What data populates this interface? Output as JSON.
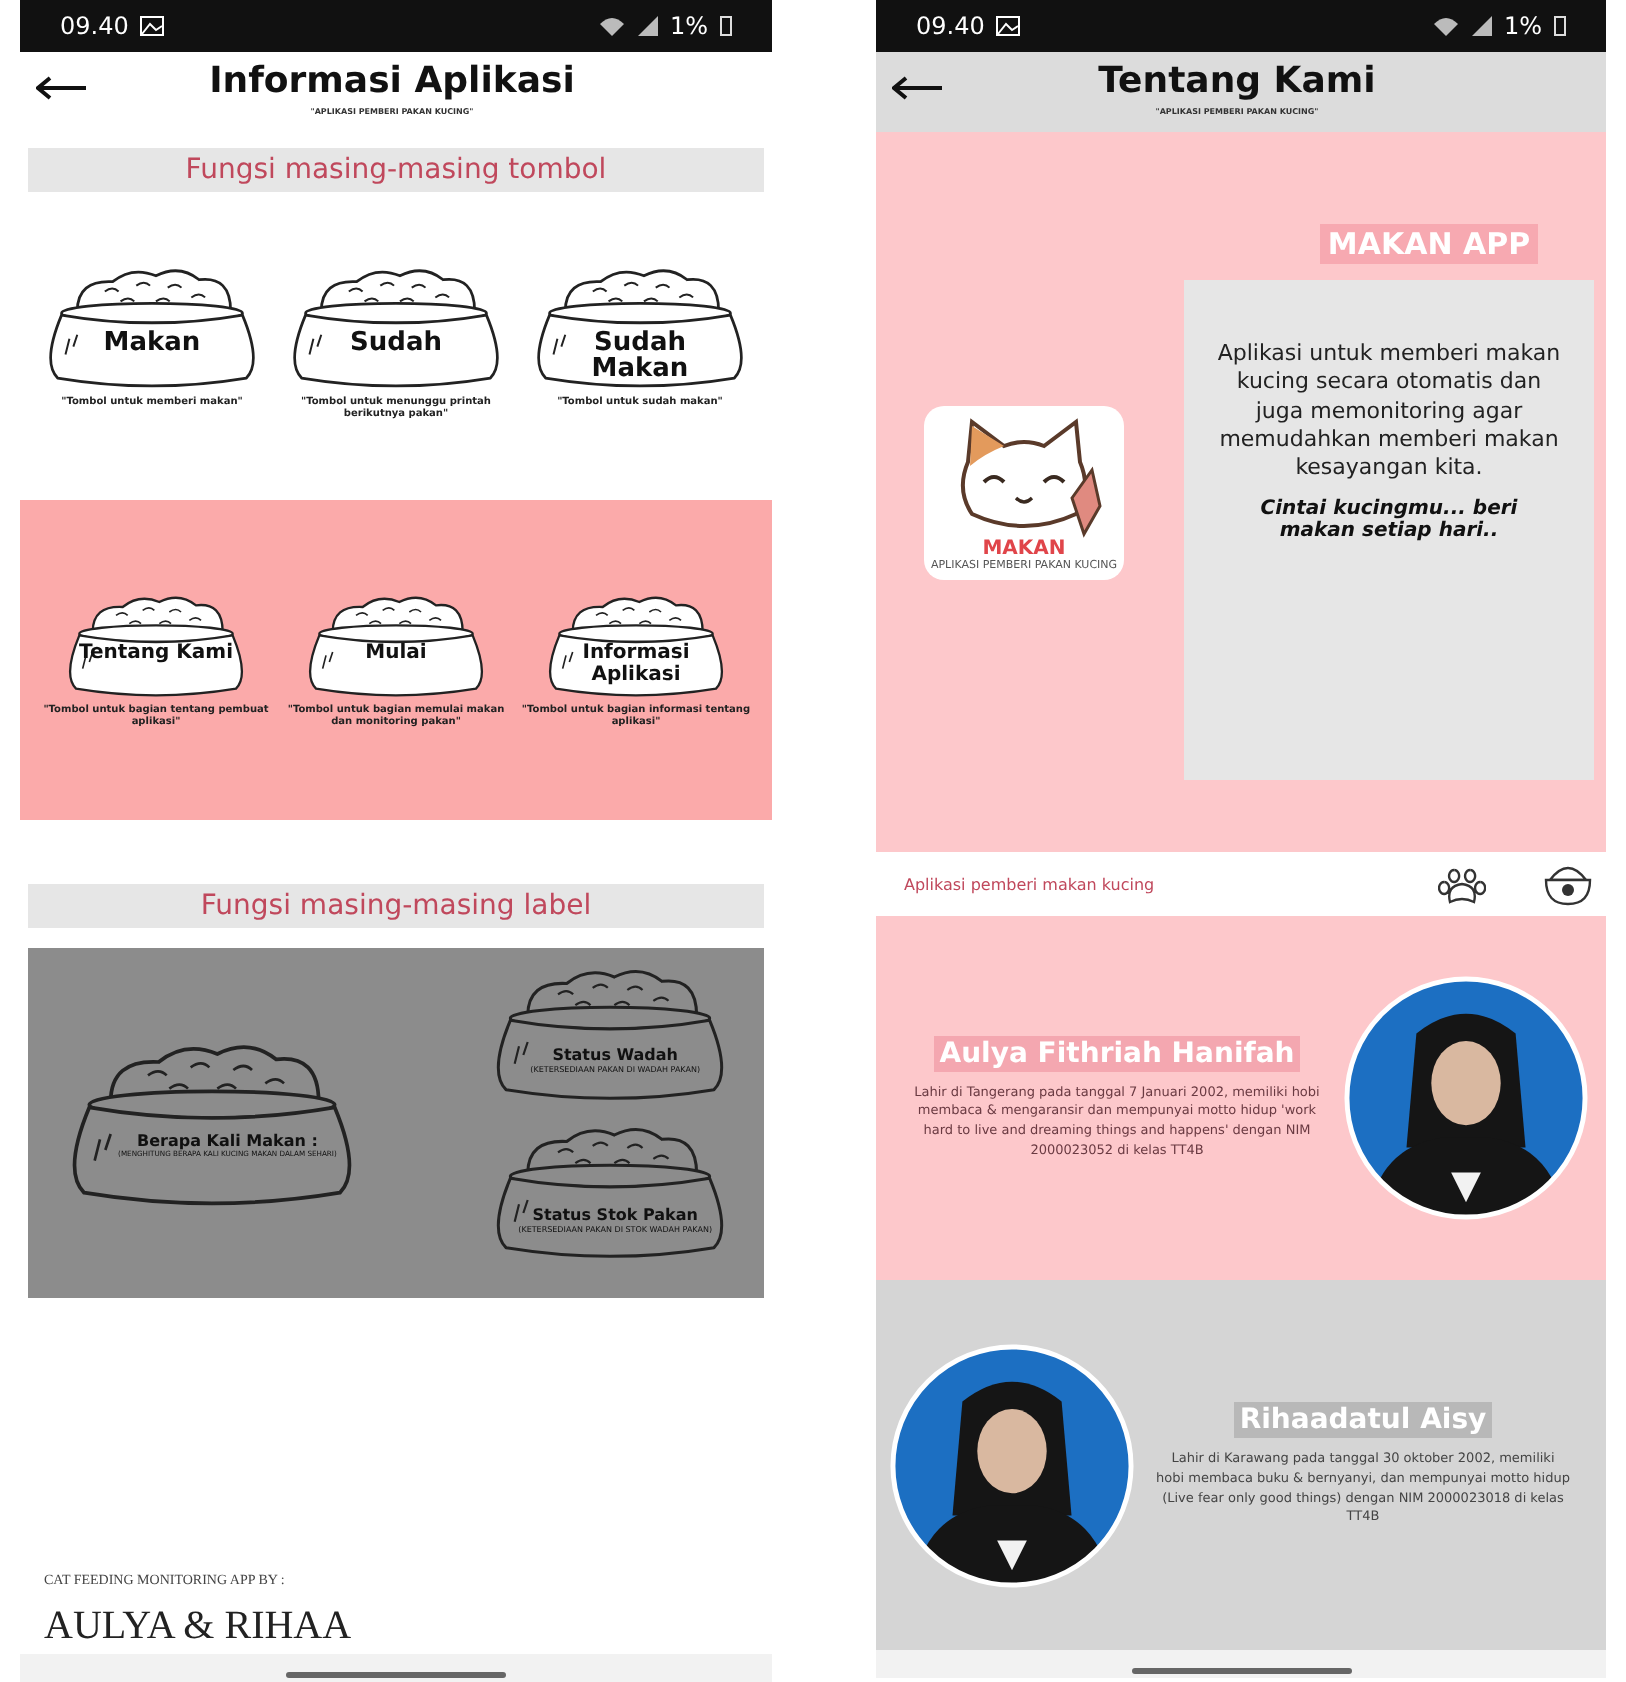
{
  "info_screen": {
    "status_bar": {
      "time": "09.40",
      "battery": "1%"
    },
    "title": "Informasi Aplikasi",
    "subtitle": "\"APLIKASI PEMBERI PAKAN KUCING\"",
    "button_heading": "Fungsi masing-masing tombol",
    "button_rows": [
      {
        "kind": "plain",
        "items": [
          {
            "label": "Makan",
            "caption": "\"Tombol untuk memberi makan\""
          },
          {
            "label": "Sudah",
            "caption": "\"Tombol untuk menunggu printah berikutnya pakan\""
          },
          {
            "label": "Sudah Makan",
            "caption": "\"Tombol untuk sudah makan\""
          }
        ]
      },
      {
        "kind": "highlighted",
        "items": [
          {
            "label": "Tentang Kami",
            "caption": "\"Tombol untuk bagian tentang pembuat aplikasi\""
          },
          {
            "label": "Mulai",
            "caption": "\"Tombol untuk bagian memulai makan dan monitoring pakan\""
          },
          {
            "label": "Informasi Aplikasi",
            "caption": "\"Tombol untuk bagian informasi tentang aplikasi\""
          }
        ]
      }
    ],
    "label_heading": "Fungsi masing-masing label",
    "labels": [
      {
        "title": "Berapa Kali Makan :",
        "caption": "(MENGHITUNG BERAPA KALI KUCING MAKAN DALAM SEHARI)"
      },
      {
        "title": "Status Wadah",
        "caption": "(KETERSEDIAAN PAKAN DI WADAH PAKAN)"
      },
      {
        "title": "Status Stok Pakan",
        "caption": "(KETERSEDIAAN PAKAN DI STOK WADAH PAKAN)"
      }
    ],
    "credit": "CAT FEEDING MONITORING APP BY :",
    "authors": "AULYA & RIHAA"
  },
  "about_screen": {
    "status_bar": {
      "time": "09.40",
      "battery": "1%"
    },
    "title": "Tentang Kami",
    "subtitle": "\"APLIKASI PEMBERI PAKAN KUCING\"",
    "app_heading": "MAKAN APP",
    "logo_text": "MAKAN",
    "logo_tagline": "APLIKASI PEMBERI PAKAN KUCING",
    "description": "Aplikasi untuk memberi makan kucing secara otomatis dan juga memonitoring agar memudahkan memberi makan kesayangan kita.",
    "motto": "Cintai kucingmu... beri makan setiap hari..",
    "strip_text": "Aplikasi pemberi makan kucing",
    "profiles": [
      {
        "name": "Aulya Fithriah Hanifah",
        "bio": "Lahir di Tangerang pada tanggal 7 Januari 2002, memiliki hobi membaca & mengaransir dan mempunyai motto hidup 'work hard to live and dreaming things and happens' dengan NIM 2000023052 di kelas TT4B"
      },
      {
        "name": "Rihaadatul Aisy",
        "bio": "Lahir di Karawang pada tanggal 30 oktober 2002, memiliki hobi membaca buku & bernyanyi, dan mempunyai motto hidup (Live fear only good things) dengan NIM 2000023018 di kelas TT4B"
      }
    ]
  }
}
